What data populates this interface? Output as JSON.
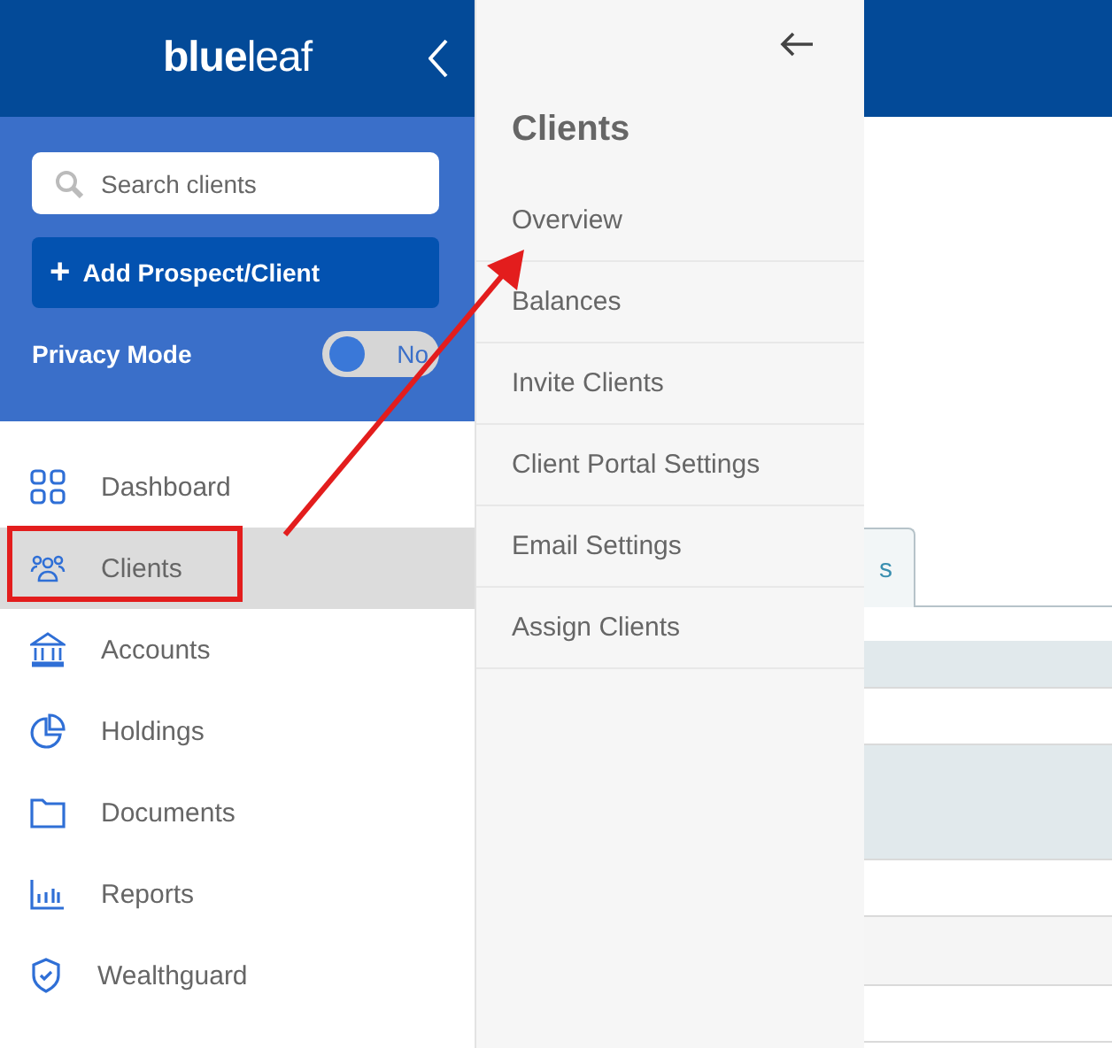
{
  "sidebar": {
    "logo": "**blue**leaf",
    "search": {
      "placeholder": "Search clients"
    },
    "add_button": {
      "icon": "+",
      "label": "Add Prospect/Client"
    },
    "privacy_mode": {
      "label": "Privacy Mode",
      "on": false,
      "state_label": "No"
    },
    "items": [
      {
        "label": "Dashboard",
        "kind": "dashboard",
        "selected": false
      },
      {
        "label": "Clients",
        "kind": "clients",
        "selected": true
      },
      {
        "label": "Accounts",
        "kind": "accounts",
        "selected": false
      },
      {
        "label": "Holdings",
        "kind": "holdings",
        "selected": false
      },
      {
        "label": "Documents",
        "kind": "documents",
        "selected": false
      },
      {
        "label": "Reports",
        "kind": "reports",
        "selected": false
      },
      {
        "label": "Wealthguard",
        "kind": "wealthguard",
        "selected": false
      }
    ]
  },
  "submenu": {
    "title": "Clients",
    "items": [
      {
        "label": "Overview"
      },
      {
        "label": "Balances"
      },
      {
        "label": "Invite Clients"
      },
      {
        "label": "Client Portal Settings"
      },
      {
        "label": "Email Settings"
      },
      {
        "label": "Assign Clients"
      }
    ]
  },
  "main": {
    "tab": {
      "label": "s",
      "selected": false
    },
    "rows": [
      {
        "kind": "header"
      },
      {
        "kind": "plain"
      },
      {
        "kind": "highlight"
      },
      {
        "kind": "plain"
      },
      {
        "kind": "striped"
      },
      {
        "kind": "plain"
      }
    ]
  }
}
